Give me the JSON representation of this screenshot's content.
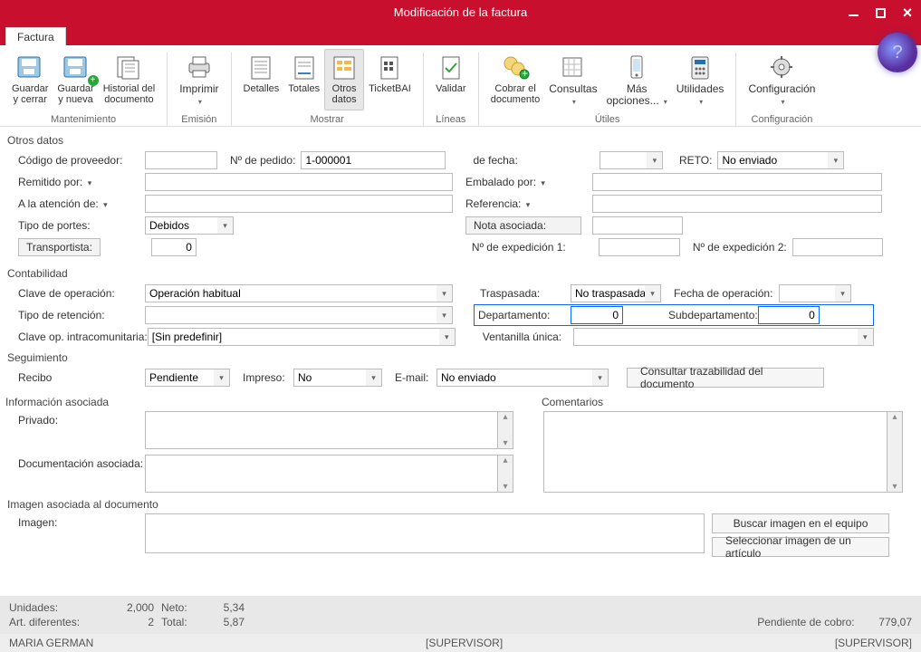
{
  "window": {
    "title": "Modificación de la factura"
  },
  "tab": "Factura",
  "ribbon": {
    "groups": {
      "mantenimiento": {
        "label": "Mantenimiento",
        "guardar_cerrar": "Guardar\ny cerrar",
        "guardar_nueva": "Guardar\ny nueva",
        "historial": "Historial del\ndocumento"
      },
      "emision": {
        "label": "Emisión",
        "imprimir": "Imprimir"
      },
      "mostrar": {
        "label": "Mostrar",
        "detalles": "Detalles",
        "totales": "Totales",
        "otros_datos": "Otros\ndatos",
        "ticketbai": "TicketBAI"
      },
      "lineas": {
        "label": "Líneas",
        "validar": "Validar"
      },
      "utiles": {
        "label": "Útiles",
        "cobrar": "Cobrar el\ndocumento",
        "consultas": "Consultas",
        "mas": "Más\nopciones...",
        "utilidades": "Utilidades"
      },
      "config": {
        "label": "Configuración",
        "configuracion": "Configuración"
      }
    }
  },
  "otros_datos": {
    "heading": "Otros datos",
    "codigo_proveedor_label": "Código de proveedor:",
    "codigo_proveedor_value": "",
    "pedido_label": "Nº de pedido:",
    "pedido_value": "1-000001",
    "de_fecha_label": "de fecha:",
    "de_fecha_value": "",
    "reto_label": "RETO:",
    "reto_value": "No enviado",
    "remitido_label": "Remitido por:",
    "remitido_value": "",
    "embalado_label": "Embalado por:",
    "embalado_value": "",
    "atencion_label": "A la atención de:",
    "atencion_value": "",
    "referencia_label": "Referencia:",
    "referencia_value": "",
    "tipo_portes_label": "Tipo de portes:",
    "tipo_portes_value": "Debidos",
    "nota_asociada_button": "Nota asociada:",
    "nota_asociada_value": "",
    "transportista_button": "Transportista:",
    "transportista_value": "0",
    "expedicion1_label": "Nº de expedición 1:",
    "expedicion1_value": "",
    "expedicion2_label": "Nº de expedición 2:",
    "expedicion2_value": ""
  },
  "contabilidad": {
    "heading": "Contabilidad",
    "clave_op_label": "Clave de operación:",
    "clave_op_value": "Operación habitual",
    "traspasada_label": "Traspasada:",
    "traspasada_value": "No traspasada",
    "fecha_op_label": "Fecha de operación:",
    "fecha_op_value": "",
    "tipo_ret_label": "Tipo de retención:",
    "tipo_ret_value": "",
    "dept_label": "Departamento:",
    "dept_value": "0",
    "subdept_label": "Subdepartamento:",
    "subdept_value": "0",
    "clave_intra_label": "Clave op. intracomunitaria:",
    "clave_intra_value": "[Sin predefinir]",
    "ventanilla_label": "Ventanilla única:",
    "ventanilla_value": ""
  },
  "seguimiento": {
    "heading": "Seguimiento",
    "recibo_label": "Recibo",
    "recibo_value": "Pendiente",
    "impreso_label": "Impreso:",
    "impreso_value": "No",
    "email_label": "E-mail:",
    "email_value": "No enviado",
    "trazabilidad_btn": "Consultar trazabilidad del documento"
  },
  "info": {
    "heading": "Información asociada",
    "privado_label": "Privado:",
    "doc_asociada_label": "Documentación asociada:",
    "comentarios_label": "Comentarios"
  },
  "imagen": {
    "heading": "Imagen asociada al documento",
    "imagen_label": "Imagen:",
    "imagen_value": "",
    "buscar_btn": "Buscar imagen en el equipo",
    "seleccionar_btn": "Seleccionar imagen de un artículo"
  },
  "summary": {
    "unidades_label": "Unidades:",
    "unidades_value": "2,000",
    "art_label": "Art. diferentes:",
    "art_value": "2",
    "neto_label": "Neto:",
    "neto_value": "5,34",
    "total_label": "Total:",
    "total_value": "5,87",
    "pendiente_label": "Pendiente de cobro:",
    "pendiente_value": "779,07"
  },
  "status": {
    "left": "MARIA GERMAN",
    "mid": "[SUPERVISOR]",
    "right": "[SUPERVISOR]"
  }
}
